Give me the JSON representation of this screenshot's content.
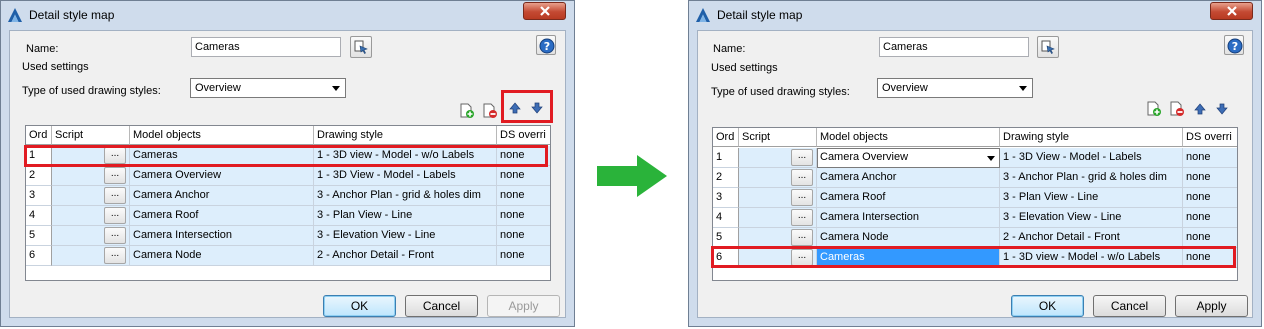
{
  "colors": {
    "highlight": "#e11b22",
    "arrow": "#2ab33a",
    "selection": "#3399ff",
    "row_bg": "#ddeefc"
  },
  "before": {
    "title": "Detail style map",
    "name_label": "Name:",
    "name_value": "Cameras",
    "used_settings_label": "Used settings",
    "type_label": "Type of used drawing styles:",
    "type_value": "Overview",
    "columns": [
      "Ord",
      "Script",
      "Model objects",
      "Drawing style",
      "DS overri"
    ],
    "rows": [
      {
        "ord": "1",
        "script_button": "...",
        "model": "Cameras",
        "style": "1 - 3D view - Model - w/o Labels",
        "ds": "none"
      },
      {
        "ord": "2",
        "script_button": "...",
        "model": "Camera Overview",
        "style": "1 - 3D View - Model - Labels",
        "ds": "none"
      },
      {
        "ord": "3",
        "script_button": "...",
        "model": "Camera Anchor",
        "style": "3 - Anchor Plan - grid & holes dim",
        "ds": "none"
      },
      {
        "ord": "4",
        "script_button": "...",
        "model": "Camera Roof",
        "style": "3 - Plan View - Line",
        "ds": "none"
      },
      {
        "ord": "5",
        "script_button": "...",
        "model": "Camera Intersection",
        "style": "3 - Elevation View - Line",
        "ds": "none"
      },
      {
        "ord": "6",
        "script_button": "...",
        "model": "Camera Node",
        "style": "2 - Anchor Detail - Front",
        "ds": "none"
      }
    ],
    "ok": "OK",
    "cancel": "Cancel",
    "apply": "Apply"
  },
  "after": {
    "title": "Detail style map",
    "name_label": "Name:",
    "name_value": "Cameras",
    "used_settings_label": "Used settings",
    "type_label": "Type of used drawing styles:",
    "type_value": "Overview",
    "columns": [
      "Ord",
      "Script",
      "Model objects",
      "Drawing style",
      "DS overri"
    ],
    "rows": [
      {
        "ord": "1",
        "script_button": "...",
        "model": "Camera Overview",
        "style": "1 - 3D View - Model - Labels",
        "ds": "none"
      },
      {
        "ord": "2",
        "script_button": "...",
        "model": "Camera Anchor",
        "style": "3 - Anchor Plan - grid & holes dim",
        "ds": "none"
      },
      {
        "ord": "3",
        "script_button": "...",
        "model": "Camera Roof",
        "style": "3 - Plan View - Line",
        "ds": "none"
      },
      {
        "ord": "4",
        "script_button": "...",
        "model": "Camera Intersection",
        "style": "3 - Elevation View - Line",
        "ds": "none"
      },
      {
        "ord": "5",
        "script_button": "...",
        "model": "Camera Node",
        "style": "2 - Anchor Detail - Front",
        "ds": "none"
      },
      {
        "ord": "6",
        "script_button": "...",
        "model": "Cameras",
        "style": "1 - 3D view - Model - w/o Labels",
        "ds": "none"
      }
    ],
    "ok": "OK",
    "cancel": "Cancel",
    "apply": "Apply"
  }
}
